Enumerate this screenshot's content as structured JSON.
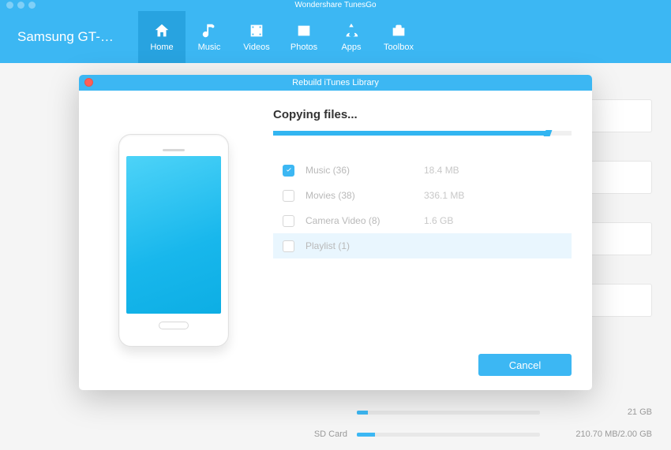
{
  "app": {
    "title": "Wondershare TunesGo"
  },
  "toolbar": {
    "device_name": "Samsung GT-N7...",
    "tabs": [
      {
        "id": "home",
        "label": "Home",
        "active": true
      },
      {
        "id": "music",
        "label": "Music",
        "active": false
      },
      {
        "id": "videos",
        "label": "Videos",
        "active": false
      },
      {
        "id": "photos",
        "label": "Photos",
        "active": false
      },
      {
        "id": "apps",
        "label": "Apps",
        "active": false
      },
      {
        "id": "toolbox",
        "label": "Toolbox",
        "active": false
      }
    ]
  },
  "storage": {
    "sdcard_label": "SD Card",
    "sdcard_text": "210.70 MB/2.00 GB",
    "sdcard_pct": 10,
    "top_text": "21 GB",
    "top_pct": 6
  },
  "modal": {
    "title": "Rebuild iTunes Library",
    "status": "Copying files...",
    "progress_pct": 92,
    "items": [
      {
        "checked": true,
        "highlight": false,
        "label": "Music (36)",
        "size": "18.4 MB"
      },
      {
        "checked": false,
        "highlight": false,
        "label": "Movies (38)",
        "size": "336.1 MB"
      },
      {
        "checked": false,
        "highlight": false,
        "label": "Camera Video (8)",
        "size": "1.6 GB"
      },
      {
        "checked": false,
        "highlight": true,
        "label": "Playlist (1)",
        "size": ""
      }
    ],
    "cancel_label": "Cancel"
  }
}
